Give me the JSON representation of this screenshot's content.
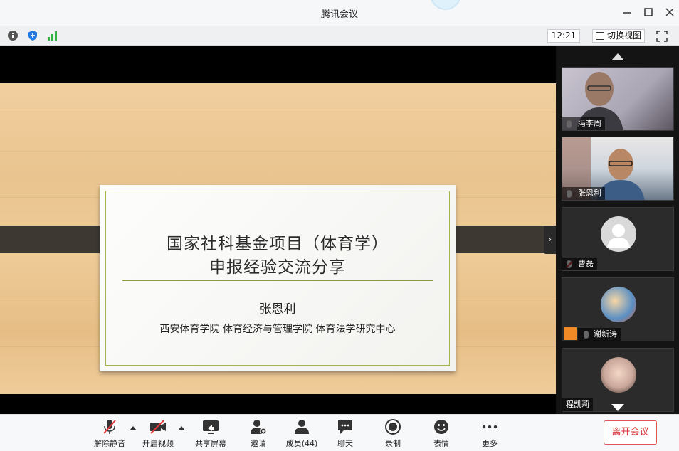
{
  "window": {
    "title": "腾讯会议"
  },
  "toolbar": {
    "time": "12:21",
    "switch_view_label": "切换视图"
  },
  "slide": {
    "title_line1": "国家社科基金项目（体育学）",
    "title_line2": "申报经验交流分享",
    "author": "张恩利",
    "affiliation": "西安体育学院  体育经济与管理学院  体育法学研究中心"
  },
  "participants": [
    {
      "name": "冯李周",
      "muted": false,
      "video": true
    },
    {
      "name": "张恩利",
      "muted": false,
      "video": true
    },
    {
      "name": "曹磊",
      "muted": true,
      "video": false
    },
    {
      "name": "谢新涛",
      "muted": false,
      "video": false
    },
    {
      "name": "程凯莉",
      "muted": false,
      "video": false
    }
  ],
  "bottombar": {
    "unmute": "解除静音",
    "start_video": "开启视频",
    "share_screen": "共享屏幕",
    "invite": "邀请",
    "members": "成员(44)",
    "chat": "聊天",
    "record": "录制",
    "reactions": "表情",
    "more": "更多",
    "leave": "离开会议"
  },
  "colors": {
    "leave_red": "#d9363b",
    "frame_green": "#a7b34b",
    "band_dark": "#3e3832"
  }
}
